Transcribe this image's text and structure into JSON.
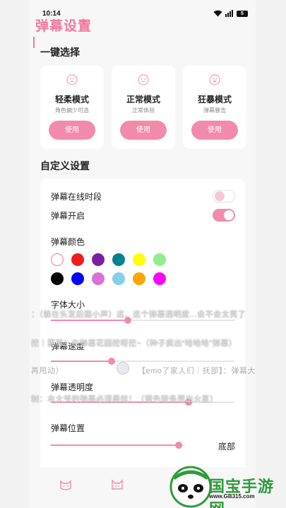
{
  "status": {
    "time": "10:14",
    "battery": "5"
  },
  "header": {
    "title": "弹幕设置",
    "sparkle": "✦"
  },
  "quick": {
    "title": "一键选择",
    "modes": [
      {
        "name": "轻柔模式",
        "desc": "角色偏少可选",
        "button": "使用",
        "icon": "face-calm-icon"
      },
      {
        "name": "正常模式",
        "desc": "正常体验",
        "button": "使用",
        "icon": "face-normal-icon"
      },
      {
        "name": "狂暴模式",
        "desc": "弹幕暴击",
        "button": "使用",
        "icon": "face-wild-icon"
      }
    ]
  },
  "custom": {
    "title": "自定义设置",
    "online_period": {
      "label": "弹幕在线时段",
      "on": false
    },
    "enabled": {
      "label": "弹幕开启",
      "on": true
    },
    "color": {
      "label": "弹幕颜色",
      "selected": 0,
      "swatches": [
        "#ffffff",
        "#ee1c1c",
        "#7b1fa2",
        "#00838f",
        "#ffff00",
        "#90ee90",
        "#000000",
        "#0000ff",
        "#da70d6",
        "#87ceeb",
        "#ffa500",
        "#ff00ff"
      ]
    },
    "font_size": {
      "label": "字体大小",
      "value": 0.42
    },
    "speed": {
      "label": "弹幕速度",
      "value": 0.33
    },
    "opacity": {
      "label": "弹幕透明度",
      "value": 0.75
    },
    "position": {
      "label": "弹幕位置",
      "value": 0.95,
      "value_label": "底部"
    }
  },
  "danmaku": [
    "：（躲在头发后面小声）这、这个弹幕透明度...会不会太亮了",
    "挖｜雾草！在弹幕花园挖呀挖~（种子疯出“哈哈哈”弹幕）",
    "再甩动）",
    "【emo了家人们｜抚部】：弹幕大",
    "制：本大爷的弹幕必须最炫！（银色链条甩出火星）"
  ],
  "nav": {
    "icons": [
      "cat-face-icon",
      "cat-outline-icon"
    ]
  },
  "watermark": {
    "text": "国宝手游网",
    "url": "www.GB315.com",
    "icon": "panda-icon"
  }
}
